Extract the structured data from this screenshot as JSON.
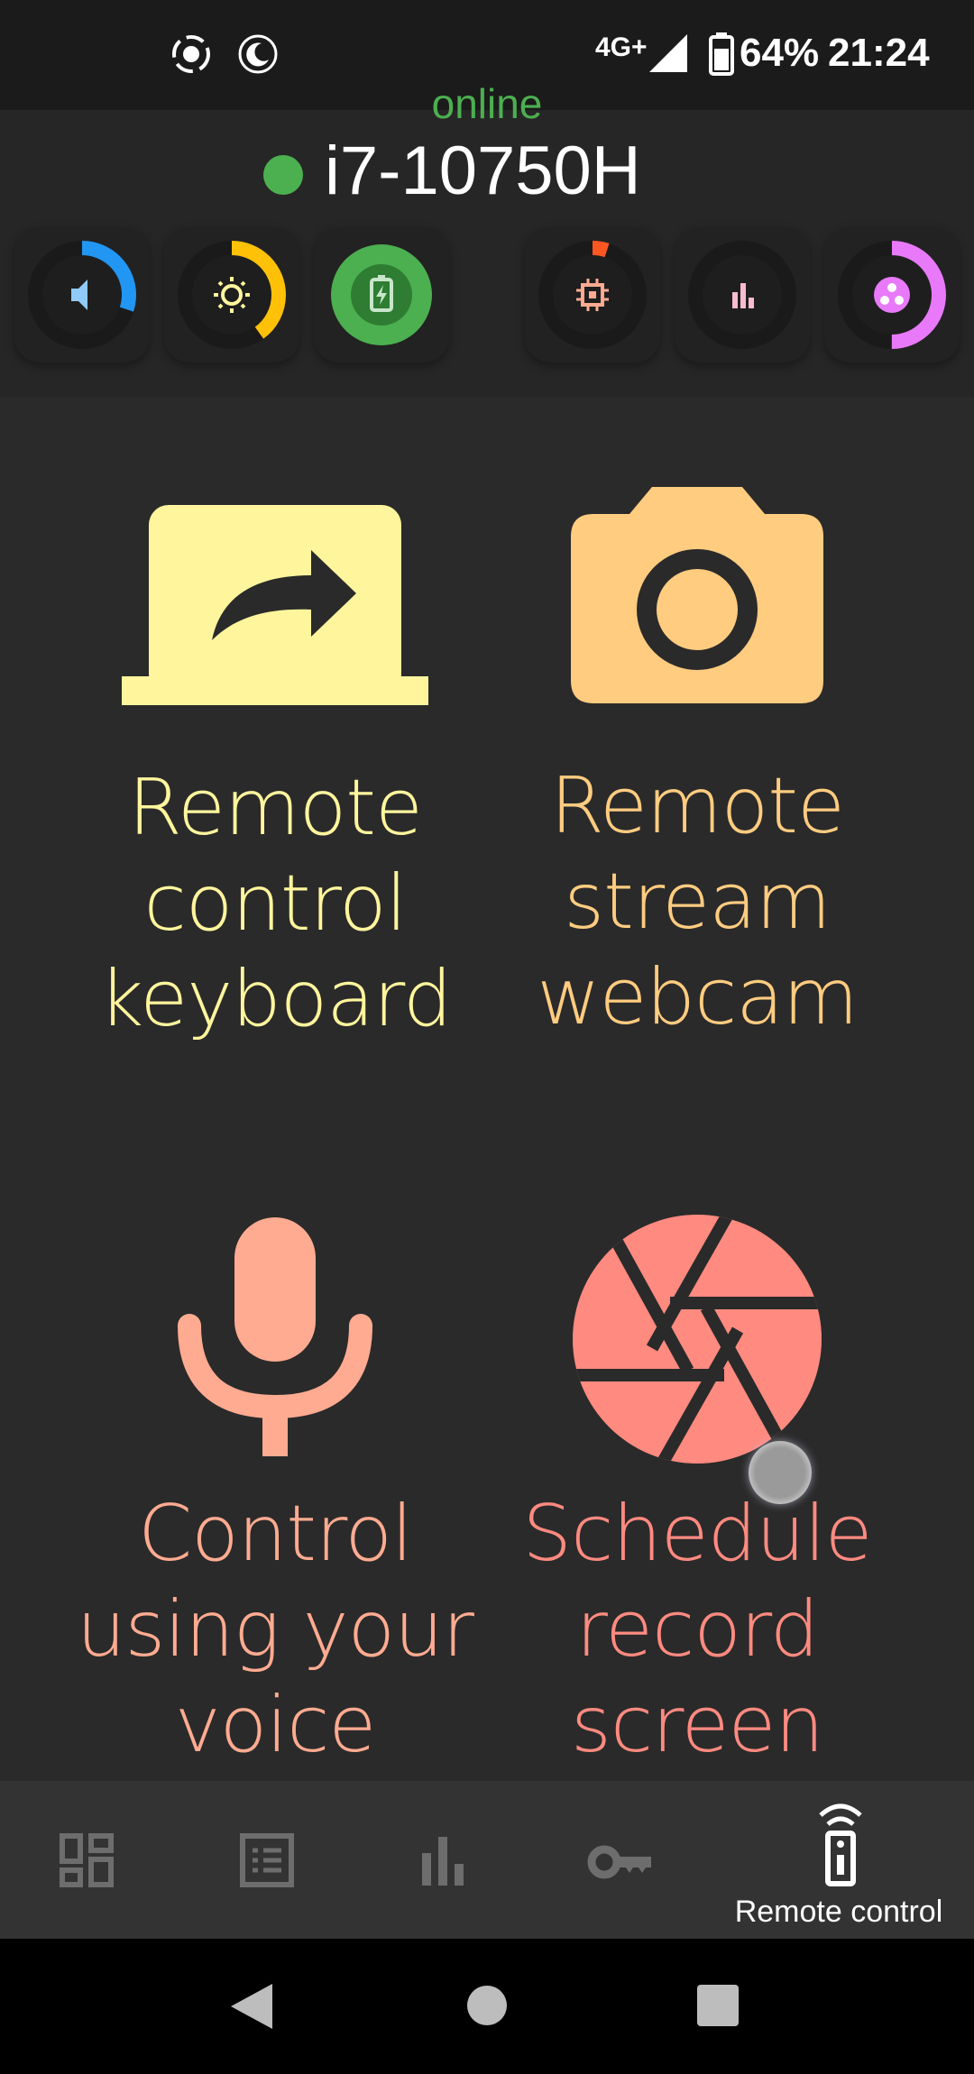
{
  "statusbar": {
    "network": "4G+",
    "battery": "64%",
    "time": "21:24"
  },
  "header": {
    "status": "online",
    "hostname": "i7-10750H"
  },
  "gauges": [
    {
      "name": "volume",
      "icon": "volume-icon",
      "level": 0.3,
      "color": "#2196f3"
    },
    {
      "name": "brightness",
      "icon": "sun-icon",
      "level": 0.4,
      "color": "#ffc107"
    },
    {
      "name": "battery",
      "icon": "battery-charging-icon",
      "level": 1.0,
      "color": "#4caf50"
    },
    {
      "name": "cpu",
      "icon": "cpu-icon",
      "level": 0.05,
      "color": "#ff5722"
    },
    {
      "name": "stats",
      "icon": "bar-chart-icon",
      "level": 0.0,
      "color": "#f48fb1"
    },
    {
      "name": "memory",
      "icon": "circles-icon",
      "level": 0.5,
      "color": "#e879f9"
    }
  ],
  "tiles": [
    {
      "label_lines": [
        "Remote",
        "control",
        "keyboard"
      ],
      "color": "#fff59d",
      "icon": "laptop-share-icon"
    },
    {
      "label_lines": [
        "Remote",
        "stream",
        "webcam"
      ],
      "color": "#ffcc80",
      "icon": "camera-icon"
    },
    {
      "label_lines": [
        "Control",
        "using your",
        "voice"
      ],
      "color": "#ffab91",
      "icon": "microphone-icon"
    },
    {
      "label_lines": [
        "Schedule",
        "record",
        "screen"
      ],
      "color": "#ff8a80",
      "icon": "aperture-icon"
    }
  ],
  "bottom_nav": {
    "items": [
      "dashboard-icon",
      "list-icon",
      "bar-chart-icon",
      "key-icon",
      "remote-control-icon"
    ],
    "active_label": "Remote control"
  },
  "colors": {
    "background": "#2a2a2a",
    "online": "#4caf50"
  }
}
